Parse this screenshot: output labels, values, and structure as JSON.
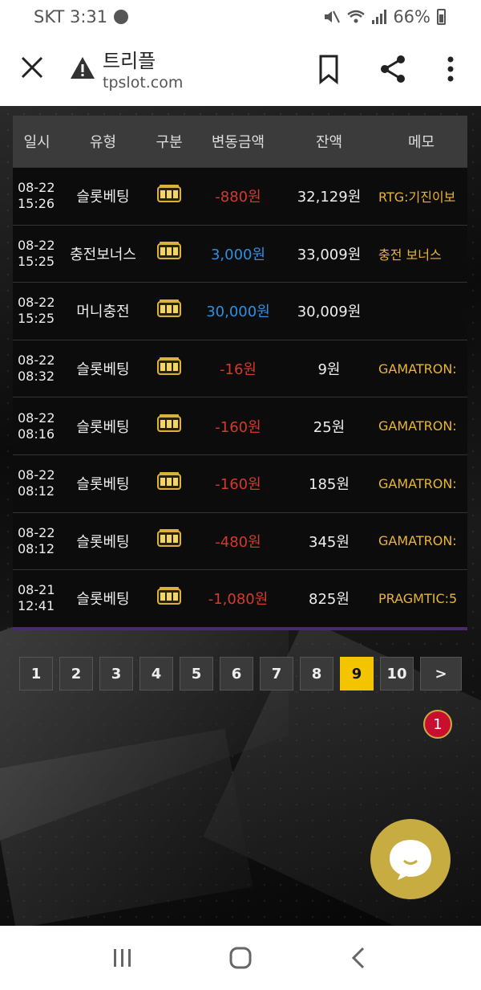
{
  "status": {
    "carrier_time": "SKT 3:31",
    "battery": "66%"
  },
  "browser": {
    "title": "트리플",
    "url": "tpslot.com"
  },
  "table": {
    "headers": [
      "일시",
      "유형",
      "구분",
      "변동금액",
      "잔액",
      "메모"
    ],
    "rows": [
      {
        "date": "08-22",
        "time": "15:26",
        "type": "슬롯베팅",
        "amount": "-880원",
        "balance": "32,129원",
        "memo": "RTG:기진이보",
        "sign": "neg"
      },
      {
        "date": "08-22",
        "time": "15:25",
        "type": "충전보너스",
        "amount": "3,000원",
        "balance": "33,009원",
        "memo": "충전 보너스",
        "sign": "pos"
      },
      {
        "date": "08-22",
        "time": "15:25",
        "type": "머니충전",
        "amount": "30,000원",
        "balance": "30,009원",
        "memo": "",
        "sign": "pos"
      },
      {
        "date": "08-22",
        "time": "08:32",
        "type": "슬롯베팅",
        "amount": "-16원",
        "balance": "9원",
        "memo": "GAMATRON:",
        "sign": "neg"
      },
      {
        "date": "08-22",
        "time": "08:16",
        "type": "슬롯베팅",
        "amount": "-160원",
        "balance": "25원",
        "memo": "GAMATRON:",
        "sign": "neg"
      },
      {
        "date": "08-22",
        "time": "08:12",
        "type": "슬롯베팅",
        "amount": "-160원",
        "balance": "185원",
        "memo": "GAMATRON:",
        "sign": "neg"
      },
      {
        "date": "08-22",
        "time": "08:12",
        "type": "슬롯베팅",
        "amount": "-480원",
        "balance": "345원",
        "memo": "GAMATRON:",
        "sign": "neg"
      },
      {
        "date": "08-21",
        "time": "12:41",
        "type": "슬롯베팅",
        "amount": "-1,080원",
        "balance": "825원",
        "memo": "PRAGMTIC:5",
        "sign": "neg"
      }
    ]
  },
  "pager": {
    "pages": [
      "1",
      "2",
      "3",
      "4",
      "5",
      "6",
      "7",
      "8",
      "9",
      "10"
    ],
    "active": "9",
    "next": ">"
  },
  "chat": {
    "badge": "1"
  },
  "colors": {
    "negative": "#d33a2c",
    "positive": "#2f8fe0",
    "memo": "#e8b530",
    "active_page": "#f5c400",
    "chat": "#c7ac42"
  }
}
